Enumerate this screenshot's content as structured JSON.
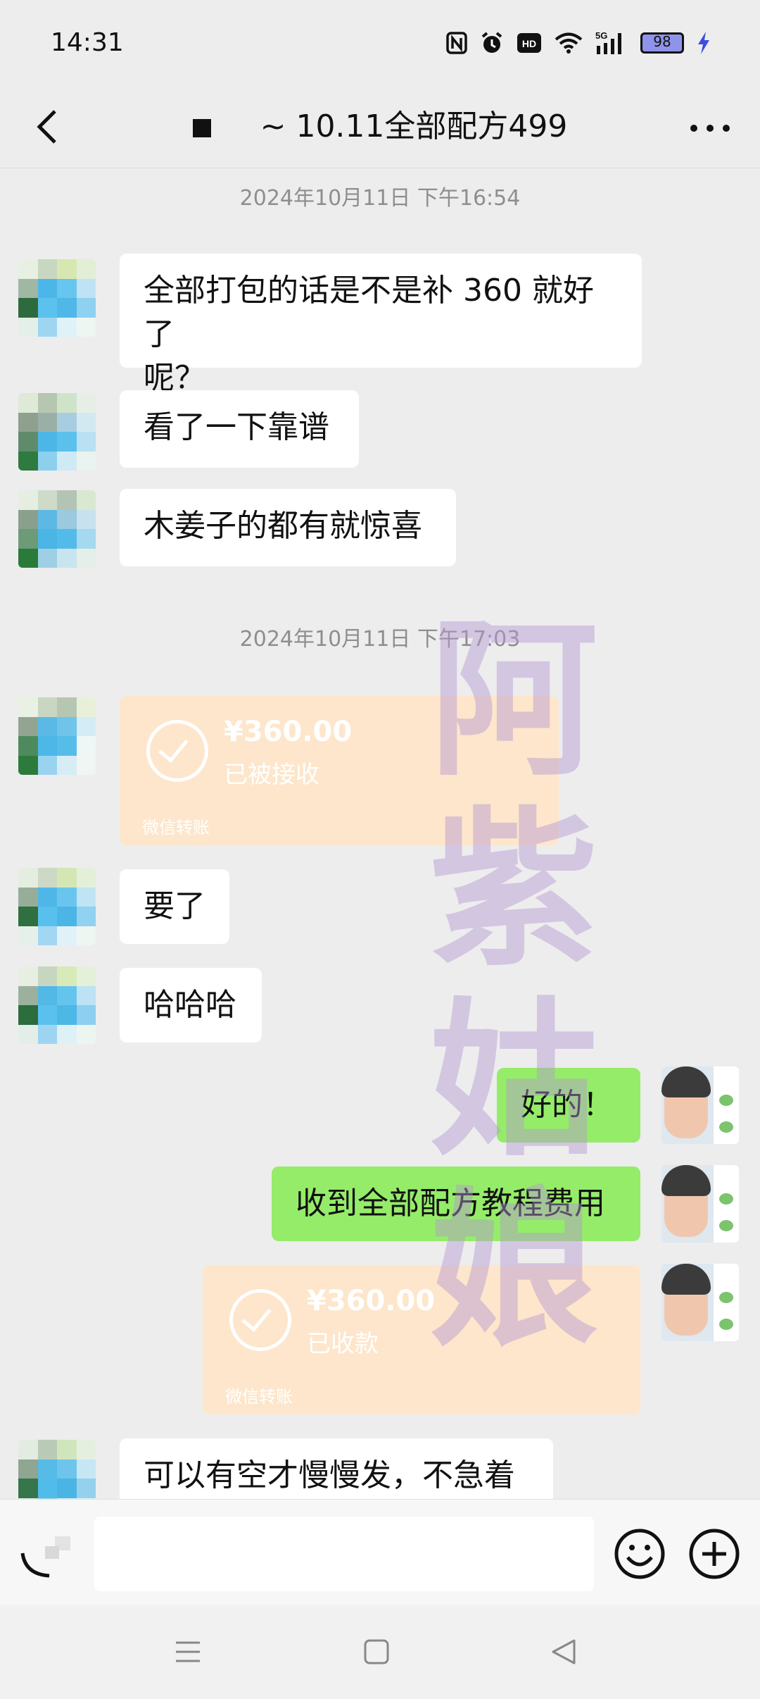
{
  "status_bar": {
    "time": "14:31",
    "battery": "98",
    "icons": [
      "nfc-icon",
      "alarm-icon",
      "hd-icon",
      "wifi-icon",
      "signal-5g-icon",
      "battery-icon",
      "charging-icon"
    ]
  },
  "header": {
    "title": "~ 10.11全部配方499",
    "back_icon": "chevron-left-icon",
    "more_icon": "more-dots-icon"
  },
  "messages": {
    "ts1": "2024年10月11日 下午16:54",
    "m1": "全部打包的话是不是补 360 就好了",
    "m1b": "呢？",
    "m2": "看了一下靠谱",
    "m3": "木姜子的都有就惊喜",
    "ts2": "2024年10月11日 下午17:03",
    "t1_amount": "¥360.00",
    "t1_status": "已被接收",
    "t1_footer": "微信转账",
    "m4": "要了",
    "m5": "哈哈哈",
    "m6": "好的！",
    "m7": "收到全部配方教程费用",
    "t2_amount": "¥360.00",
    "t2_status": "已收款",
    "t2_footer": "微信转账",
    "m8": "可以有空才慢慢发，不急着"
  },
  "watermark": {
    "chars": [
      "阿",
      "紫",
      "姑",
      "娘"
    ]
  },
  "input_bar": {
    "placeholder": "",
    "voice_icon": "voice-icon",
    "emoji_icon": "emoji-icon",
    "plus_icon": "plus-icon"
  },
  "system_nav": {
    "icons": [
      "menu-icon",
      "home-icon",
      "back-triangle-icon"
    ]
  },
  "colors": {
    "background": "#ededed",
    "self_bubble": "#95ec69",
    "other_bubble": "#ffffff",
    "transfer_card": "#fde6cb",
    "watermark": "#b496d2"
  }
}
